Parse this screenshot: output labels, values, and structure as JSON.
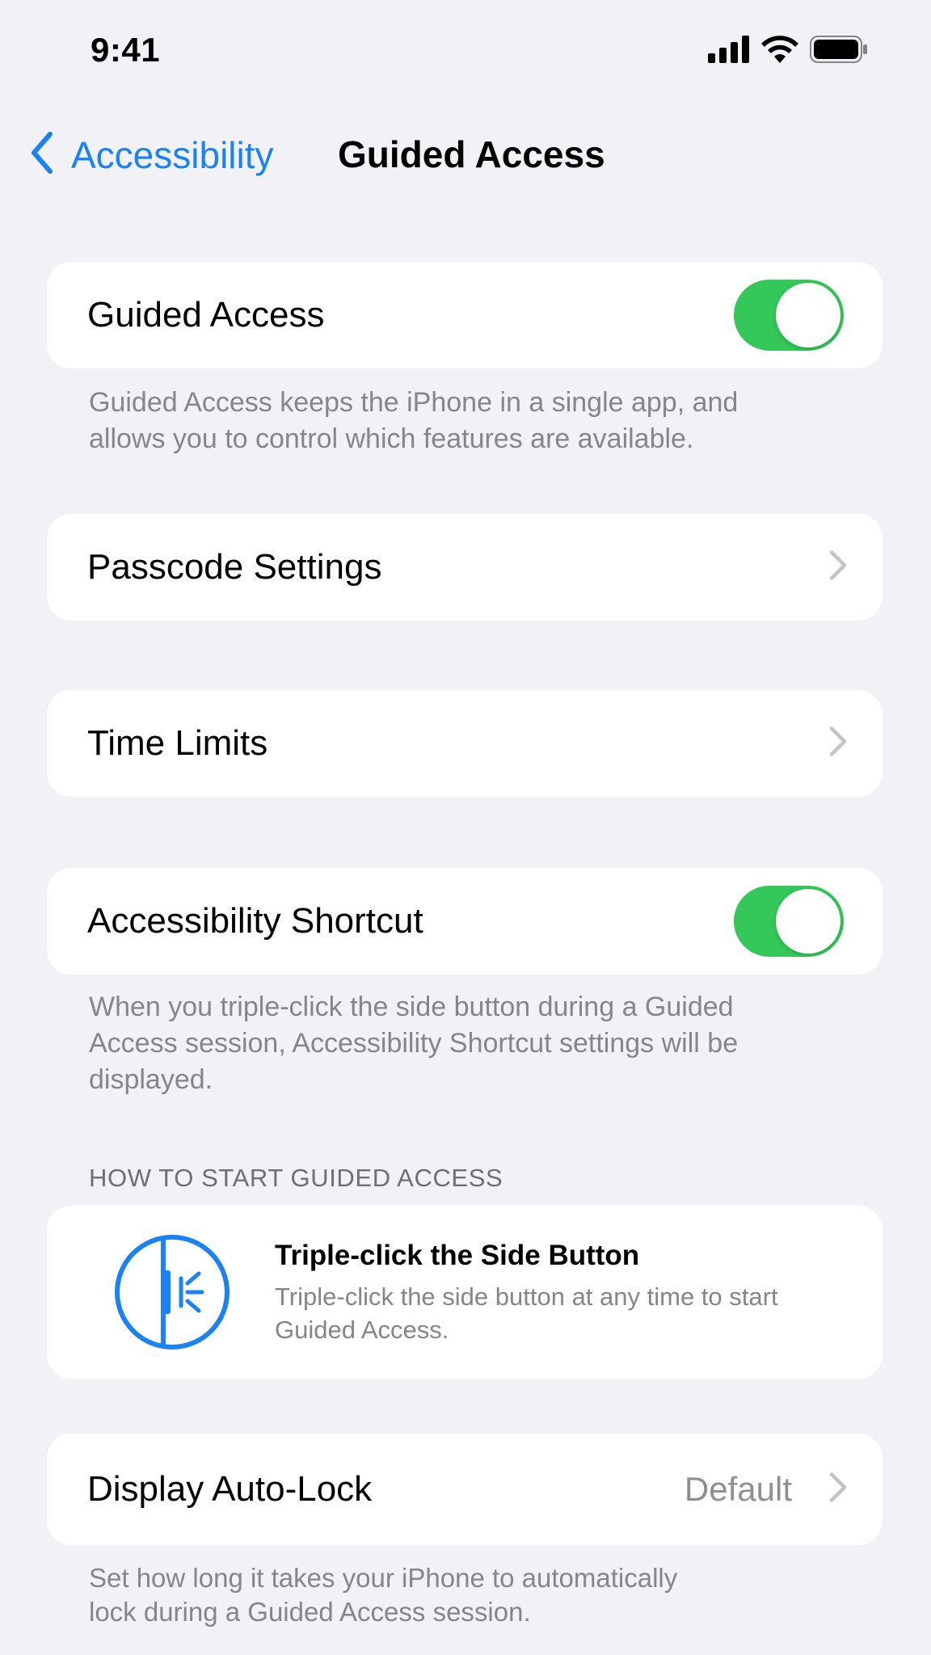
{
  "status_bar": {
    "time": "9:41",
    "icons": [
      "cellular-signal-icon",
      "wifi-icon",
      "battery-icon"
    ]
  },
  "nav": {
    "back_label": "Accessibility",
    "title": "Guided Access"
  },
  "groups": {
    "guided_access": {
      "label": "Guided Access",
      "toggle_on": true,
      "footer": "Guided Access keeps the iPhone in a single app, and allows you to control which features are available."
    },
    "passcode_settings": {
      "label": "Passcode Settings"
    },
    "time_limits": {
      "label": "Time Limits"
    },
    "accessibility_shortcut": {
      "label": "Accessibility Shortcut",
      "toggle_on": true,
      "footer": "When you triple-click the side button during a Guided Access session, Accessibility Shortcut settings will be displayed."
    },
    "how_to_start": {
      "header": "HOW TO START GUIDED ACCESS",
      "title": "Triple-click the Side Button",
      "description": "Triple-click the side button at any time to start Guided Access.",
      "icon": "side-button-icon"
    },
    "display_auto_lock": {
      "label": "Display Auto-Lock",
      "value": "Default",
      "footer": "Set how long it takes your iPhone to automatically lock during a Guided Access session."
    }
  },
  "colors": {
    "background": "#f1f1f6",
    "accent": "#1a82f4",
    "toggle_on": "#34c759",
    "secondary_text": "#85858a"
  }
}
